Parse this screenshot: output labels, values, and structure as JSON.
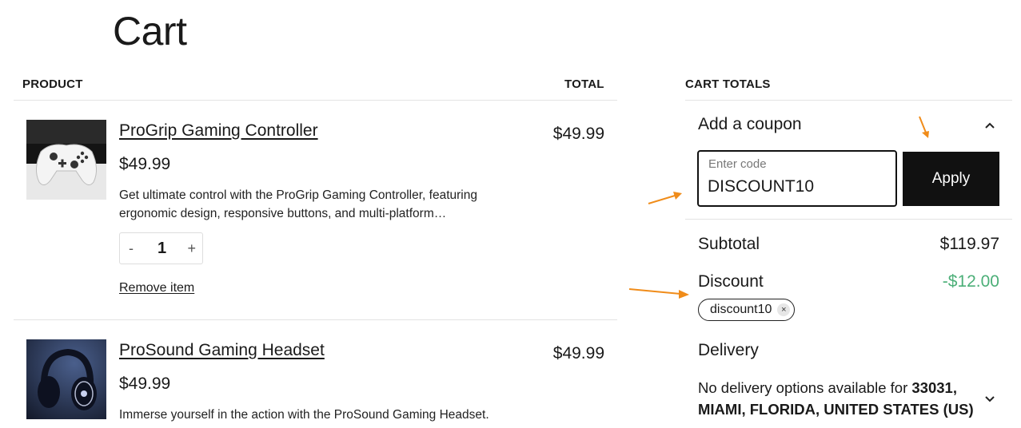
{
  "page": {
    "title": "Cart"
  },
  "table": {
    "product_header": "PRODUCT",
    "total_header": "TOTAL"
  },
  "items": [
    {
      "name": "ProGrip Gaming Controller",
      "price": "$49.99",
      "description_line1": "Get ultimate control with the ProGrip Gaming Controller, featuring",
      "description_line2": "ergonomic design, responsive buttons, and multi-platform…",
      "total": "$49.99",
      "quantity": "1",
      "qty_minus": "-",
      "qty_plus": "+",
      "remove_label": "Remove item",
      "image_icon": "controller-image"
    },
    {
      "name": "ProSound Gaming Headset",
      "price": "$49.99",
      "description_line1": "Immerse yourself in the action with the ProSound Gaming Headset.",
      "total": "$49.99",
      "image_icon": "headset-image"
    }
  ],
  "totals": {
    "header": "CART TOTALS",
    "coupon": {
      "toggle_label": "Add a coupon",
      "input_label": "Enter code",
      "input_value": "DISCOUNT10",
      "apply_label": "Apply"
    },
    "subtotal_label": "Subtotal",
    "subtotal_value": "$119.97",
    "discount_label": "Discount",
    "discount_value": "-$12.00",
    "discount_color": "#4caf78",
    "applied_coupon": "discount10",
    "chip_remove": "×",
    "delivery_label": "Delivery",
    "delivery_text_prefix": "No delivery options available for ",
    "delivery_location_line1": "33031,",
    "delivery_location_line2": "MIAMI, FLORIDA, UNITED STATES (US)"
  },
  "annotation": {
    "arrow_color": "#f08c1a"
  }
}
